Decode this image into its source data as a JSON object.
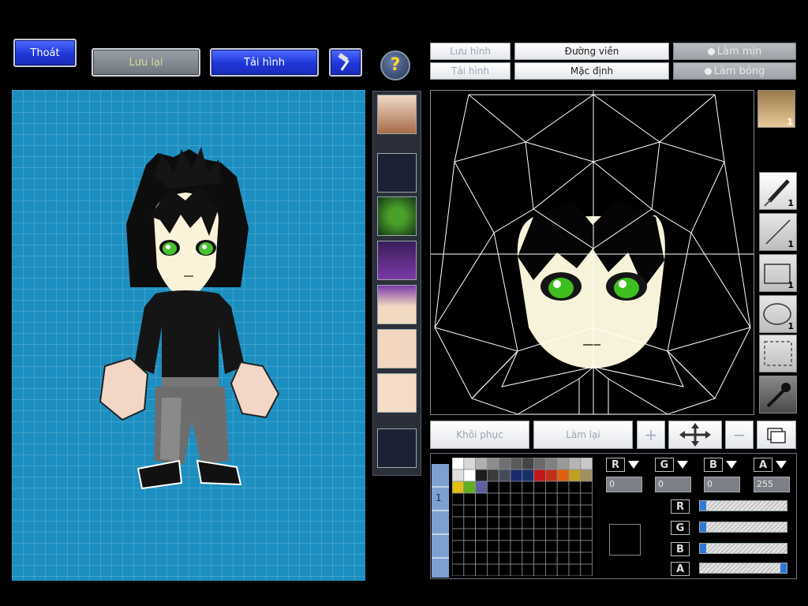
{
  "top_left": {
    "exit": "Thoát",
    "save": "Lưu lại",
    "reload": "Tải hình",
    "tool_icon": "hammer-icon",
    "help_icon": "question-icon"
  },
  "editor_top": {
    "save_image": "Lưu hình",
    "load_image": "Tải hình",
    "outline": "Đường viền",
    "default": "Mặc định",
    "smooth": "Làm mịn",
    "shade": "Làm bóng"
  },
  "bottom_actions": {
    "restore": "Khôi phục",
    "redo": "Làm lại"
  },
  "tools": [
    {
      "name": "brush-icon",
      "count": "1"
    },
    {
      "name": "line-icon",
      "count": "1"
    },
    {
      "name": "rectangle-icon",
      "count": "1"
    },
    {
      "name": "ellipse-icon",
      "count": "1"
    },
    {
      "name": "select-icon",
      "count": ""
    },
    {
      "name": "eyedropper-icon",
      "count": ""
    }
  ],
  "face_badge": "1",
  "palette_tab": "1",
  "channels": {
    "r_label": "R",
    "g_label": "G",
    "b_label": "B",
    "a_label": "A",
    "r_value": "0",
    "g_value": "0",
    "b_value": "0",
    "a_value": "255",
    "r_level": 0.0,
    "g_level": 0.0,
    "b_level": 0.0,
    "a_level": 1.0
  },
  "palette_colors": [
    "#ffffff",
    "#d8d8d8",
    "#b0b0b0",
    "#8c8c8c",
    "#707070",
    "#5a5a5a",
    "#454545",
    "#6a6a6a",
    "#808080",
    "#9a9a9a",
    "#b5b5b5",
    "#c8c8c8",
    "#e0e0e0",
    "#ffffff",
    "#1c1c1c",
    "#3a3a3a",
    "#444a5a",
    "#1a2a6a",
    "#18306a",
    "#c01818",
    "#c03018",
    "#e06010",
    "#c0a020",
    "#a09060",
    "#e0c010",
    "#60b020",
    "#6060a0"
  ],
  "colors": {
    "accent_blue": "#1f36d8",
    "canvas_blue": "#1c8fc0"
  }
}
